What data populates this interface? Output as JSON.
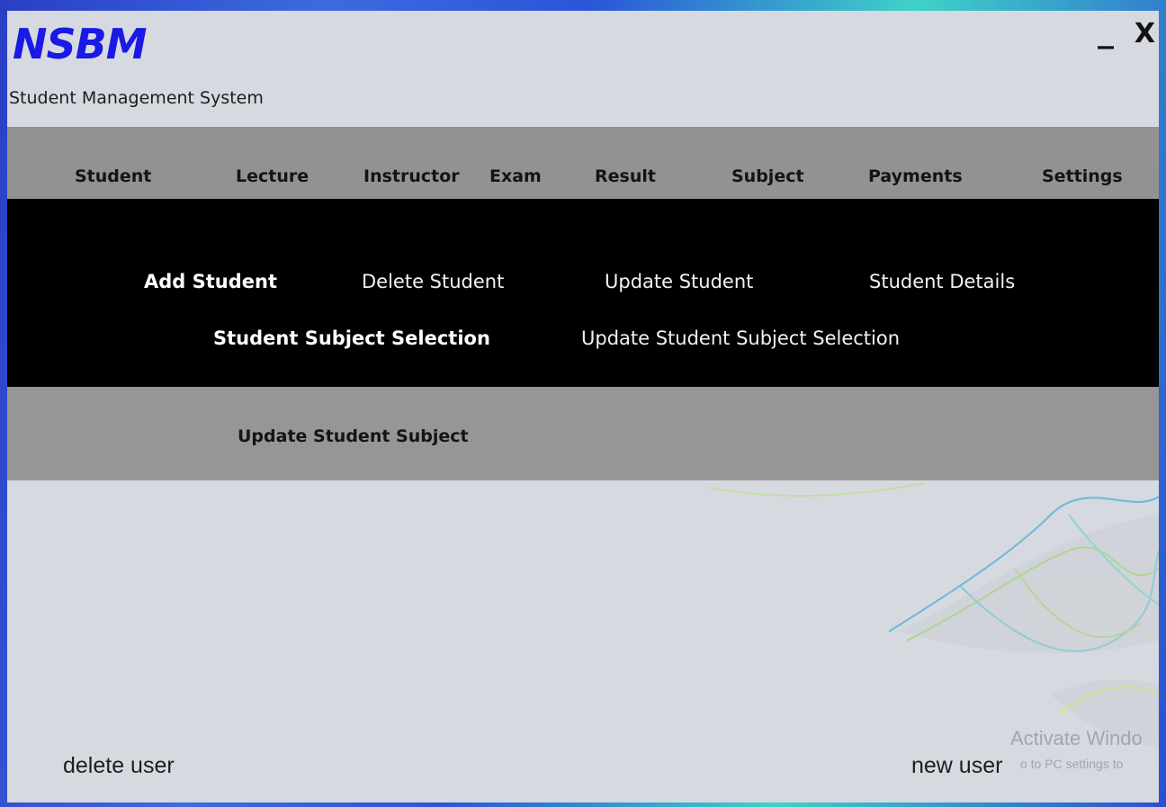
{
  "app": {
    "logo_text": "NSBM",
    "subtitle": "Student Management System",
    "minimize_label": "_",
    "close_label": "X",
    "brand_color": "#1a1ae6"
  },
  "menu": {
    "items": [
      "Student",
      "Lecture",
      "Instructor",
      "Exam",
      "Result",
      "Subject",
      "Payments",
      "Settings"
    ]
  },
  "submenu": {
    "add_student": "Add Student",
    "delete_student": "Delete Student",
    "update_student": "Update Student",
    "student_details": "Student Details",
    "student_subject_selection": "Student Subject Selection",
    "update_student_subject_selection": "Update Student Subject Selection"
  },
  "subsubmenu": {
    "update_student_subject": "Update Student Subject"
  },
  "footer": {
    "delete_user": "delete user",
    "new_user": "new user"
  },
  "watermark": {
    "title": "Activate Windo",
    "subtitle": "o to PC settings to"
  }
}
